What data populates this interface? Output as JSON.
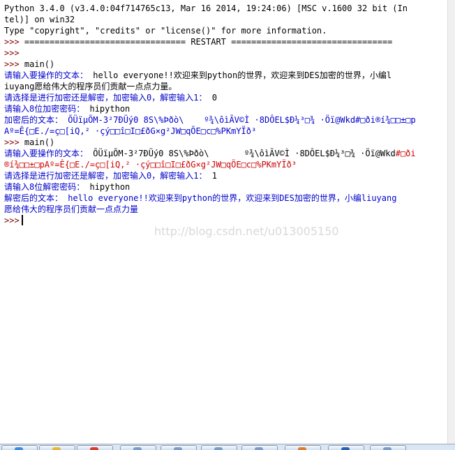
{
  "shell": {
    "header_line1": "Python 3.4.0 (v3.4.0:04f714765c13, Mar 16 2014, 19:24:06) [MSC v.1600 32 bit (In",
    "header_line2": "tel)] on win32",
    "header_line3": "Type \"copyright\", \"credits\" or \"license()\" for more information.",
    "prompt": ">>> ",
    "restart_line": "================================ RESTART ================================",
    "empty_prompt": ">>>",
    "cmd_main": "main()",
    "run1": {
      "input_label": "请输入要操作的文本：",
      "input_value_line1": "hello everyone!!欢迎来到python的世界，欢迎来到DES加密的世界，小编l",
      "input_value_line2": "iuyang愿给伟大的程序员们贡献一点点力量。",
      "mode_label": "请选择是进行加密还是解密，加密输入0，解密输入1：",
      "mode_value": "0",
      "key_label": "请输入8位加密密码：",
      "key_value": "hipython",
      "result_label": "加密后的文本：",
      "result_line1": "ÕÜïµÕM-3²7ÐÜý0 8S\\%Þðò\\    º¾\\ôìÃV©Ì ·8DÔEL$Ð¼³□¾ ·Öï@Wkd#□ði®í¾□□±□p",
      "result_line2": "Aº=Ê{□E./=ç□[iQ,² ·çý□□î□I□£ðG×g²JW□qÖE□c□%PKmYÏð³"
    },
    "run2": {
      "input_label": "请输入要操作的文本：",
      "input_value_line1": "ÕÜïµÕM-3²7ÐÜý0 8S\\%Þðò\\       º¾\\ôìÃV©Ì ·8DÔEL$Ð¼³□¾ ·Öï@Wkd",
      "input_value_line1_red": "#□ði",
      "input_value_line2": "®í¾□□±□pAº=Ê{□E./=ç□[iQ,² ·çý□□î□I□£ðG×g²JW□qÖE□c□%PKmYÏð³",
      "mode_label": "请选择是进行加密还是解密，加密输入0，解密输入1：",
      "mode_value": "1",
      "key_label": "请输入8位解密密码：",
      "key_value": "hipython",
      "result_label": "解密后的文本：",
      "result_line1": "hello everyone!!欢迎来到python的世界，欢迎来到DES加密的世界，小编liuyang",
      "result_line2": "愿给伟大的程序员们贡献一点点力量"
    },
    "final_prompt": ">>>"
  },
  "watermark": "http://blog.csdn.net/u013005150",
  "colors": {
    "stdout": "#0000cc",
    "stderr_red": "#cc0000",
    "prompt": "#800000",
    "background": "#ffffff"
  },
  "taskbar": {
    "button_icons": [
      "ie-icon",
      "folder-icon",
      "media-icon",
      "window-icon",
      "window-icon",
      "window-icon",
      "window-icon",
      "idle-icon",
      "word-icon",
      "window-icon"
    ]
  }
}
